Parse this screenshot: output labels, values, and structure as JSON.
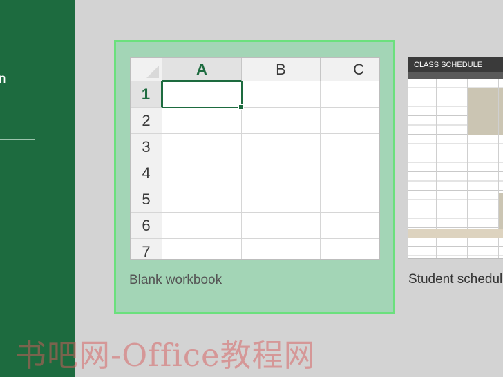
{
  "sidebar": {
    "fragment_text": "n"
  },
  "templates": {
    "blank": {
      "label": "Blank workbook",
      "columns": [
        "A",
        "B",
        "C"
      ],
      "rows": [
        "1",
        "2",
        "3",
        "4",
        "5",
        "6",
        "7"
      ],
      "active_cell": "A1"
    },
    "student": {
      "label": "Student schedule",
      "preview_title": "CLASS SCHEDULE"
    }
  },
  "watermark": "书吧网-Office教程网",
  "colors": {
    "sidebar": "#1d6b3f",
    "selected_tile": "#a3d5b6",
    "selected_border": "#6be07d",
    "background": "#d3d3d3"
  }
}
